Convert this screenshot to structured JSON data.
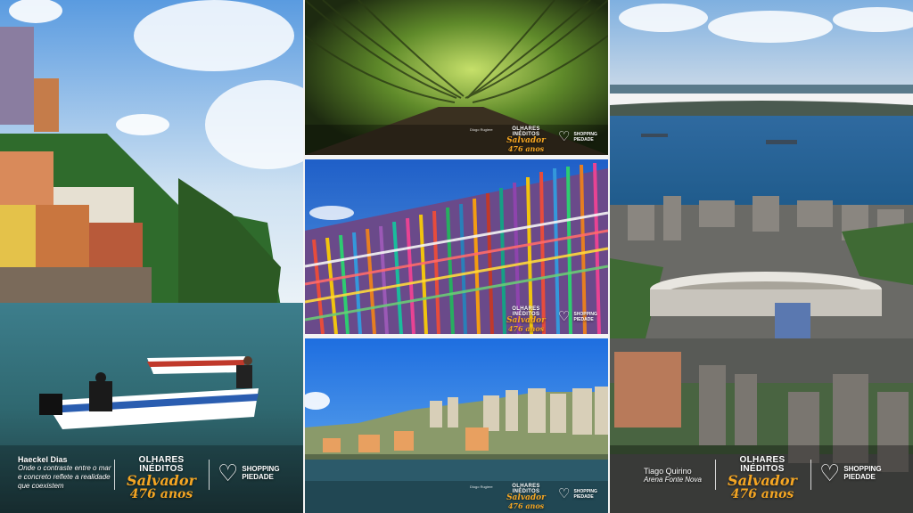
{
  "left_panel": {
    "photographer": "Haeckel Dias",
    "caption_lines": [
      "Onde o contraste entre o mar",
      "e concreto reflete a realidade",
      "que coexistem"
    ]
  },
  "event_logo": {
    "line1": "OLHARES",
    "line2": "INÉDITOS",
    "line3": "Salvador",
    "line4": "476 anos"
  },
  "brand": {
    "name_line1": "SHOPPING",
    "name_line2": "PIEDADE"
  },
  "middle_top": {
    "photographer": "Diogo Rugiere"
  },
  "middle_mid": {
    "photographer": ""
  },
  "middle_bottom": {
    "photographer": "Diogo Rugiere"
  },
  "right_panel": {
    "photographer": "Tiago Quirino",
    "caption": "Arena Fonte Nova"
  }
}
